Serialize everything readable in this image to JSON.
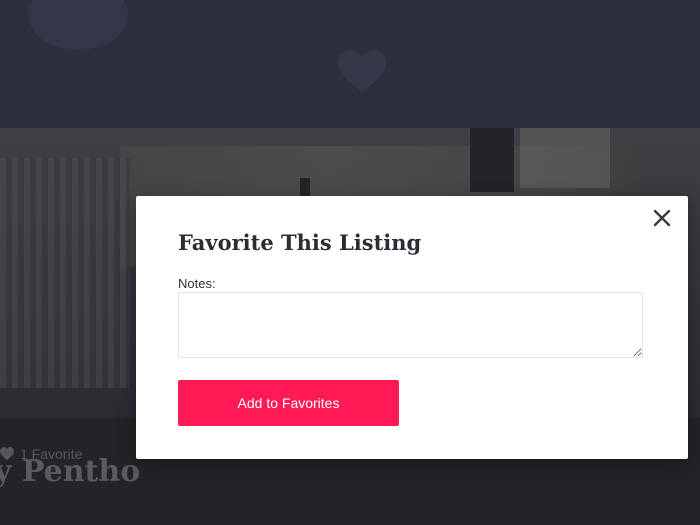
{
  "background": {
    "listing_title": "y Pentho",
    "favorites_count_label": "1 Favorite"
  },
  "modal": {
    "title": "Favorite This Listing",
    "notes_label": "Notes:",
    "notes_value": "",
    "notes_placeholder": "",
    "submit_label": "Add to Favorites",
    "close_icon": "close-icon"
  },
  "colors": {
    "header_bg": "#2e2f3c",
    "accent": "#ff1a55",
    "modal_bg": "#ffffff",
    "title_text": "#2c2c34"
  }
}
